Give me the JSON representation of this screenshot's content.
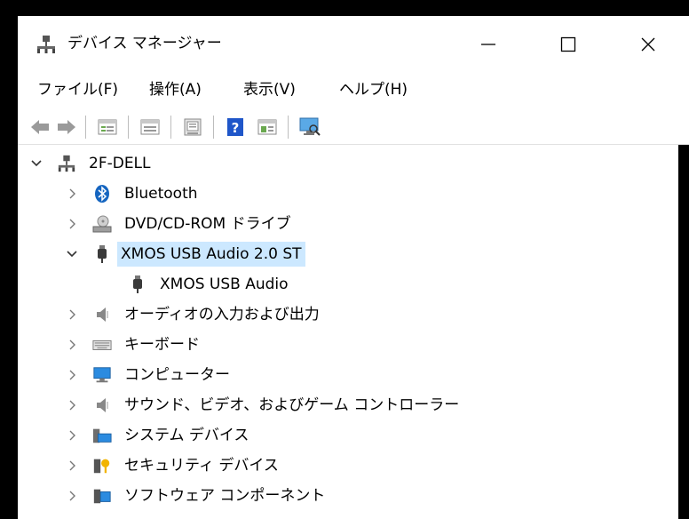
{
  "window": {
    "title": "デバイス マネージャー"
  },
  "menu": [
    "ファイル(F)",
    "操作(A)",
    "表示(V)",
    "ヘルプ(H)"
  ],
  "toolbar": {
    "buttons": [
      "back-arrow-icon",
      "forward-arrow-icon",
      "properties-icon",
      "update-driver-icon",
      "help-icon",
      "show-hidden-icon",
      "monitor-icon"
    ]
  },
  "tree": {
    "root": "2F-DELL",
    "items": [
      {
        "label": "Bluetooth",
        "icon": "bluetooth-icon",
        "expanded": false
      },
      {
        "label": "DVD/CD-ROM ドライブ",
        "icon": "dvd-drive-icon",
        "expanded": false
      },
      {
        "label": "XMOS USB Audio 2.0 ST",
        "icon": "usb-audio-icon",
        "expanded": true,
        "selected": true
      },
      {
        "label": "XMOS USB Audio",
        "icon": "usb-audio-icon",
        "child": true
      },
      {
        "label": "オーディオの入力および出力",
        "icon": "speaker-icon",
        "expanded": false
      },
      {
        "label": "キーボード",
        "icon": "keyboard-icon",
        "expanded": false
      },
      {
        "label": "コンピューター",
        "icon": "computer-icon",
        "expanded": false
      },
      {
        "label": "サウンド、ビデオ、およびゲーム コントローラー",
        "icon": "speaker-icon",
        "expanded": false
      },
      {
        "label": "システム デバイス",
        "icon": "system-devices-icon",
        "expanded": false
      },
      {
        "label": "セキュリティ デバイス",
        "icon": "security-key-icon",
        "expanded": false
      },
      {
        "label": "ソフトウェア コンポーネント",
        "icon": "software-component-icon",
        "expanded": false
      }
    ]
  }
}
